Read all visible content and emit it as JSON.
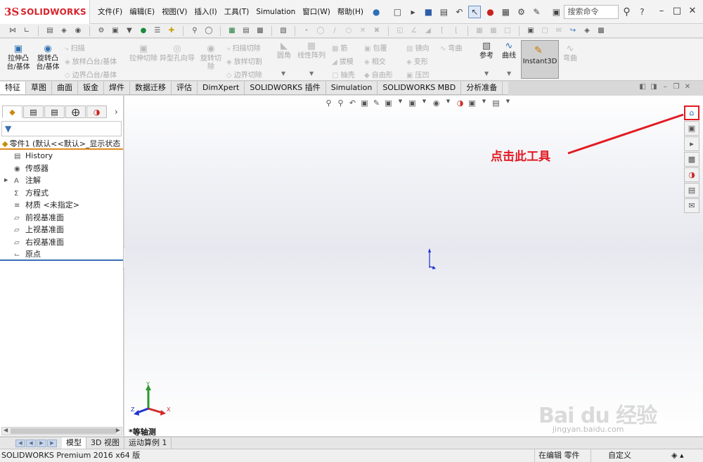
{
  "app": {
    "logo_mark": "3S",
    "logo_text": "SOLIDWORKS"
  },
  "menu": [
    "文件(F)",
    "编辑(E)",
    "视图(V)",
    "插入(I)",
    "工具(T)",
    "Simulation",
    "窗口(W)",
    "帮助(H)"
  ],
  "search": {
    "placeholder": "搜索命令"
  },
  "ribbon": {
    "extrude": "拉伸凸台/基体",
    "revolve": "旋转凸台/基体",
    "sweep": "扫描",
    "loft": "放样凸台/基体",
    "boundary": "边界凸台/基体",
    "extrude_cut": "拉伸切除",
    "hole_wizard": "异型孔向导",
    "revolve_cut": "旋转切除",
    "swept_cut": "扫描切除",
    "lofted_cut": "放样切割",
    "boundary_cut": "边界切除",
    "fillet": "圆角",
    "linear_pattern": "线性阵列",
    "rib": "筋",
    "draft": "拔模",
    "shell": "抽壳",
    "wrap": "包覆",
    "intersect": "相交",
    "freeform": "自由形",
    "mirror": "镜向",
    "deform": "变形",
    "indent": "压凹",
    "flex": "弯曲",
    "reference": "参考",
    "curves": "曲线",
    "instant3d": "Instant3D",
    "flex2": "弯曲"
  },
  "tabs": [
    "特征",
    "草图",
    "曲面",
    "钣金",
    "焊件",
    "数据迁移",
    "评估",
    "DimXpert",
    "SOLIDWORKS 插件",
    "Simulation",
    "SOLIDWORKS MBD",
    "分析准备"
  ],
  "tree": {
    "root": "零件1 (默认<<默认>_显示状态",
    "items": [
      {
        "label": "History",
        "icon": "history-icon"
      },
      {
        "label": "传感器",
        "icon": "sensor-icon"
      },
      {
        "label": "注解",
        "icon": "annotation-icon"
      },
      {
        "label": "方程式",
        "icon": "equation-icon"
      },
      {
        "label": "材质 <未指定>",
        "icon": "material-icon"
      },
      {
        "label": "前视基准面",
        "icon": "plane-icon"
      },
      {
        "label": "上视基准面",
        "icon": "plane-icon"
      },
      {
        "label": "右视基准面",
        "icon": "plane-icon"
      },
      {
        "label": "原点",
        "icon": "origin-icon"
      }
    ]
  },
  "viewport": {
    "annotation": "点击此工具",
    "view_name": "*等轴测",
    "triad": {
      "x": "X",
      "y": "Y",
      "z": "Z"
    }
  },
  "bottom_tabs": [
    "模型",
    "3D 视图",
    "运动算例 1"
  ],
  "status": {
    "version": "SOLIDWORKS Premium 2016 x64 版",
    "mode": "在编辑 零件",
    "custom": "自定义"
  },
  "watermark": {
    "main": "Bai du 经验",
    "sub": "jingyan.baidu.com"
  },
  "colors": {
    "brand": "#d8232a",
    "annotation": "#e21b22",
    "accent": "#2c6fb9",
    "tree_root_line": "#e08a1e"
  }
}
